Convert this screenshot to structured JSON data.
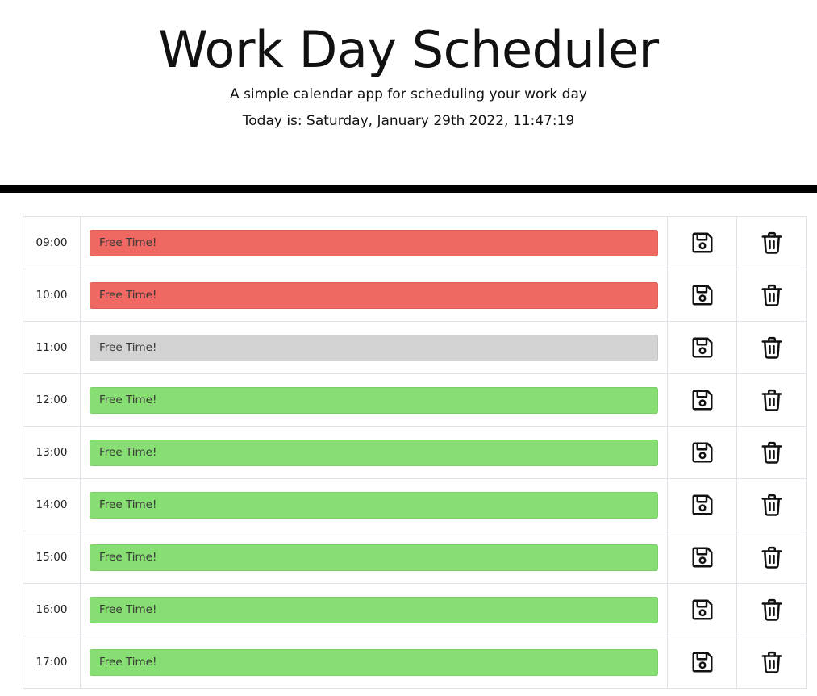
{
  "header": {
    "title": "Work Day Scheduler",
    "subtitle": "A simple calendar app for scheduling your work day",
    "today": "Today is: Saturday, January 29th 2022, 11:47:19"
  },
  "colors": {
    "past": "#f06862",
    "present": "#d3d3d3",
    "future": "#87de72",
    "divider": "#000000"
  },
  "rows": [
    {
      "hour": "09:00",
      "placeholder": "Free Time!",
      "status": "past",
      "save_icon": "floppy-disk-icon",
      "delete_icon": "trash-icon"
    },
    {
      "hour": "10:00",
      "placeholder": "Free Time!",
      "status": "past",
      "save_icon": "floppy-disk-icon",
      "delete_icon": "trash-icon"
    },
    {
      "hour": "11:00",
      "placeholder": "Free Time!",
      "status": "present",
      "save_icon": "floppy-disk-icon",
      "delete_icon": "trash-icon"
    },
    {
      "hour": "12:00",
      "placeholder": "Free Time!",
      "status": "future",
      "save_icon": "floppy-disk-icon",
      "delete_icon": "trash-icon"
    },
    {
      "hour": "13:00",
      "placeholder": "Free Time!",
      "status": "future",
      "save_icon": "floppy-disk-icon",
      "delete_icon": "trash-icon"
    },
    {
      "hour": "14:00",
      "placeholder": "Free Time!",
      "status": "future",
      "save_icon": "floppy-disk-icon",
      "delete_icon": "trash-icon"
    },
    {
      "hour": "15:00",
      "placeholder": "Free Time!",
      "status": "future",
      "save_icon": "floppy-disk-icon",
      "delete_icon": "trash-icon"
    },
    {
      "hour": "16:00",
      "placeholder": "Free Time!",
      "status": "future",
      "save_icon": "floppy-disk-icon",
      "delete_icon": "trash-icon"
    },
    {
      "hour": "17:00",
      "placeholder": "Free Time!",
      "status": "future",
      "save_icon": "floppy-disk-icon",
      "delete_icon": "trash-icon"
    }
  ]
}
